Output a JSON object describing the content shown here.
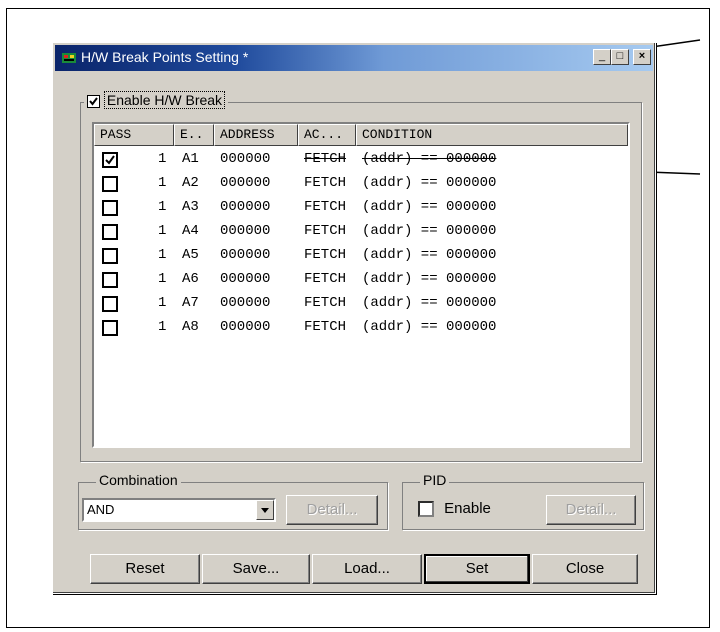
{
  "window": {
    "title": "H/W Break Points Setting *"
  },
  "title_buttons": {
    "minimize": "_",
    "maximize": "□",
    "close": "×"
  },
  "enable_break": {
    "label": "Enable H/W Break",
    "checked": true
  },
  "columns": [
    "PASS",
    "E..",
    "ADDRESS",
    "AC...",
    "CONDITION"
  ],
  "rows": [
    {
      "checked": true,
      "pass": "1",
      "event": "A1",
      "address": "000000",
      "access": "FETCH",
      "condition": "(addr) == 000000"
    },
    {
      "checked": false,
      "pass": "1",
      "event": "A2",
      "address": "000000",
      "access": "FETCH",
      "condition": "(addr) == 000000"
    },
    {
      "checked": false,
      "pass": "1",
      "event": "A3",
      "address": "000000",
      "access": "FETCH",
      "condition": "(addr) == 000000"
    },
    {
      "checked": false,
      "pass": "1",
      "event": "A4",
      "address": "000000",
      "access": "FETCH",
      "condition": "(addr) == 000000"
    },
    {
      "checked": false,
      "pass": "1",
      "event": "A5",
      "address": "000000",
      "access": "FETCH",
      "condition": "(addr) == 000000"
    },
    {
      "checked": false,
      "pass": "1",
      "event": "A6",
      "address": "000000",
      "access": "FETCH",
      "condition": "(addr) == 000000"
    },
    {
      "checked": false,
      "pass": "1",
      "event": "A7",
      "address": "000000",
      "access": "FETCH",
      "condition": "(addr) == 000000"
    },
    {
      "checked": false,
      "pass": "1",
      "event": "A8",
      "address": "000000",
      "access": "FETCH",
      "condition": "(addr) == 000000"
    }
  ],
  "combination": {
    "legend": "Combination",
    "value": "AND",
    "detail_label": "Detail..."
  },
  "pid": {
    "legend": "PID",
    "enable_label": "Enable",
    "enable_checked": false,
    "detail_label": "Detail..."
  },
  "buttons": {
    "reset": "Reset",
    "save": "Save...",
    "load": "Load...",
    "set": "Set",
    "close": "Close"
  }
}
